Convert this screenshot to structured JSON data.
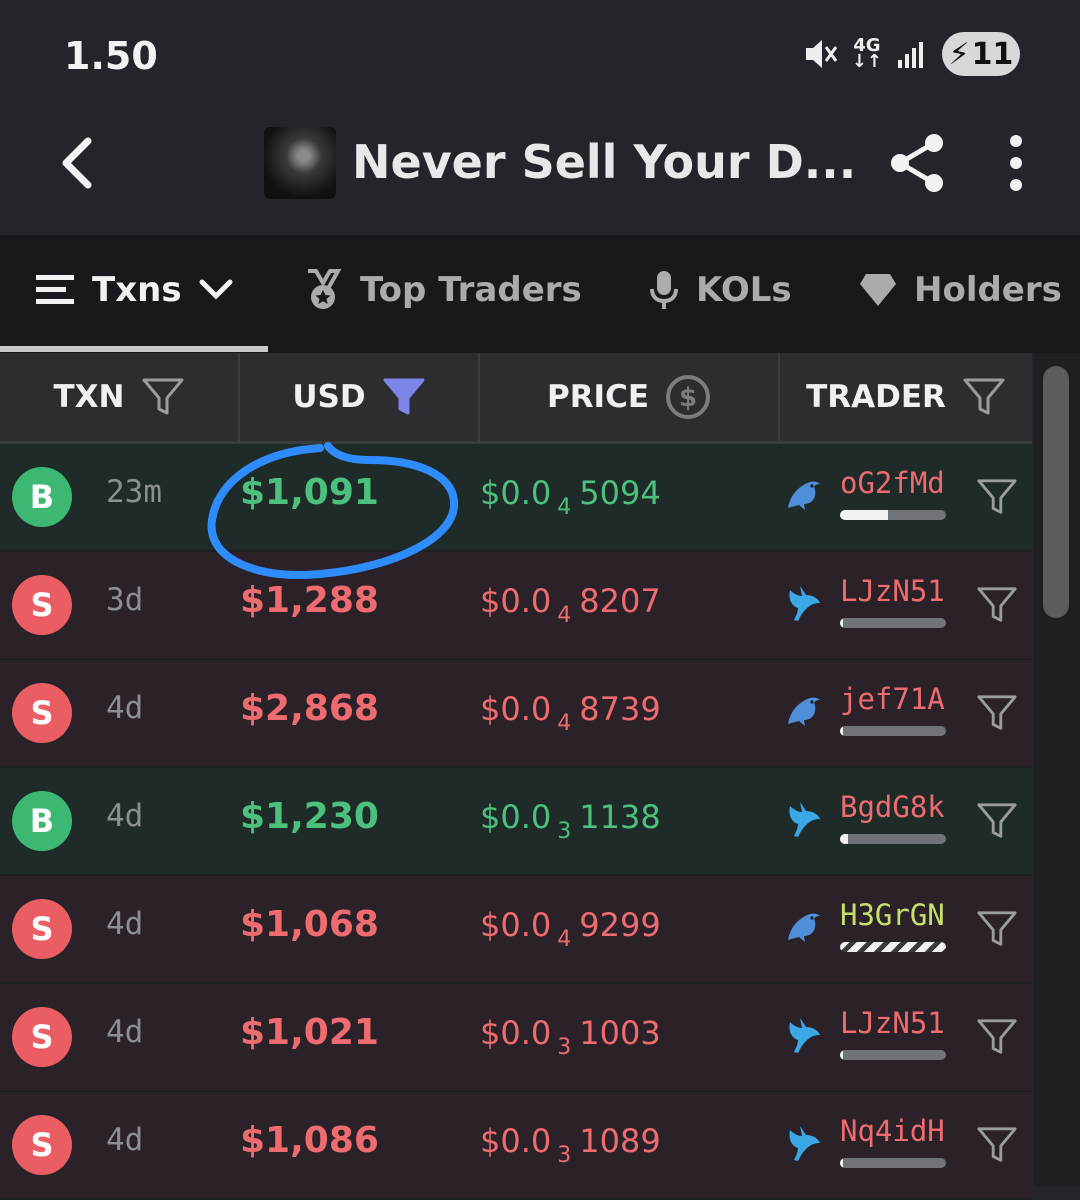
{
  "status": {
    "time": "1.50",
    "network": "4G",
    "battery": "11"
  },
  "header": {
    "title": "Never Sell Your D..."
  },
  "tabs": [
    {
      "label": "Txns",
      "active": true
    },
    {
      "label": "Top Traders",
      "active": false
    },
    {
      "label": "KOLs",
      "active": false
    },
    {
      "label": "Holders",
      "active": false
    }
  ],
  "columns": {
    "txn": "TXN",
    "usd": "USD",
    "price": "PRICE",
    "trader": "TRADER"
  },
  "colors": {
    "buy": "#3cb873",
    "sell": "#ea5d63",
    "usd_filter_active": "#7b86e8",
    "annotation": "#2f8cff"
  },
  "rows": [
    {
      "type": "B",
      "side": "buy",
      "age": "23m",
      "usd": "$1,091",
      "price_prefix": "$0.0",
      "price_zeros": "4",
      "price_digits": "5094",
      "trader_icon": "dolphin-icon",
      "trader": "oG2fMd",
      "holding": 0.45
    },
    {
      "type": "S",
      "side": "sell",
      "age": "3d",
      "usd": "$1,288",
      "price_prefix": "$0.0",
      "price_zeros": "4",
      "price_digits": "8207",
      "trader_icon": "whale-icon",
      "trader": "LJzN51",
      "holding": 0.03
    },
    {
      "type": "S",
      "side": "sell",
      "age": "4d",
      "usd": "$2,868",
      "price_prefix": "$0.0",
      "price_zeros": "4",
      "price_digits": "8739",
      "trader_icon": "dolphin-icon",
      "trader": "jef71A",
      "holding": 0.03
    },
    {
      "type": "B",
      "side": "buy",
      "age": "4d",
      "usd": "$1,230",
      "price_prefix": "$0.0",
      "price_zeros": "3",
      "price_digits": "1138",
      "trader_icon": "whale-icon",
      "trader": "BgdG8k",
      "holding": 0.08
    },
    {
      "type": "S",
      "side": "sell",
      "age": "4d",
      "usd": "$1,068",
      "price_prefix": "$0.0",
      "price_zeros": "4",
      "price_digits": "9299",
      "trader_icon": "dolphin-icon",
      "trader": "H3GrGN",
      "holding": 1.0
    },
    {
      "type": "S",
      "side": "sell",
      "age": "4d",
      "usd": "$1,021",
      "price_prefix": "$0.0",
      "price_zeros": "3",
      "price_digits": "1003",
      "trader_icon": "whale-icon",
      "trader": "LJzN51",
      "holding": 0.03
    },
    {
      "type": "S",
      "side": "sell",
      "age": "4d",
      "usd": "$1,086",
      "price_prefix": "$0.0",
      "price_zeros": "3",
      "price_digits": "1089",
      "trader_icon": "whale-icon",
      "trader": "Nq4idH",
      "holding": 0.03
    }
  ]
}
